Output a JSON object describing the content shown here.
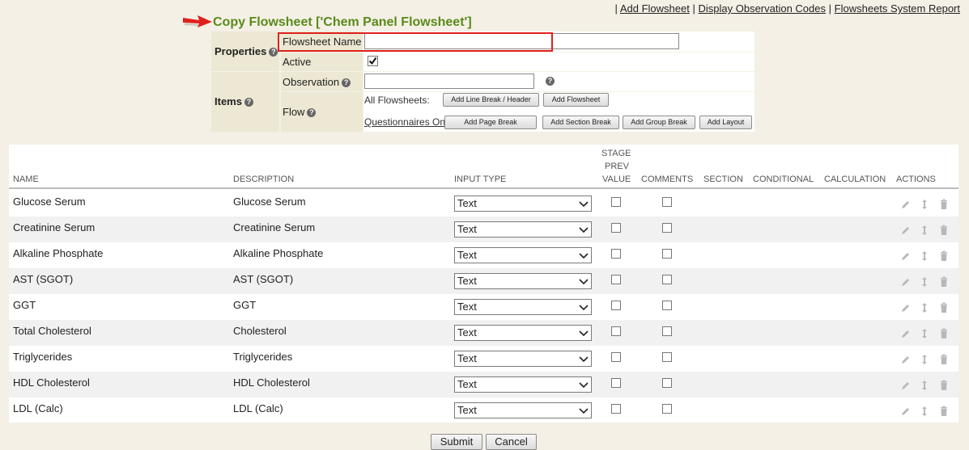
{
  "header": {
    "links": [
      "Add Flowsheet",
      "Display Observation Codes",
      "Flowsheets System Report"
    ],
    "separator": "|",
    "title": "Copy Flowsheet ['Chem Panel Flowsheet']"
  },
  "properties": {
    "section_label": "Properties",
    "flowsheet_name_label": "Flowsheet Name",
    "flowsheet_name_value": "",
    "active_label": "Active",
    "active_checked": true
  },
  "items": {
    "section_label": "Items",
    "observation_label": "Observation",
    "observation_value": "",
    "flow_label": "Flow",
    "all_flowsheets_label": "All Flowsheets:",
    "add_line_break_label": "Add Line Break / Header",
    "add_flowsheet_label": "Add Flowsheet",
    "questionnaires_only_label": "Questionnaires Only",
    "colon": ":",
    "add_page_break_label": "Add Page Break",
    "add_section_break_label": "Add Section Break",
    "add_group_break_label": "Add Group Break",
    "add_layout_label": "Add Layout"
  },
  "table": {
    "columns": {
      "name": "NAME",
      "description": "DESCRIPTION",
      "input_type": "INPUT TYPE",
      "stage_prev_value": [
        "STAGE",
        "PREV",
        "VALUE"
      ],
      "comments": "COMMENTS",
      "section": "SECTION",
      "conditional": "CONDITIONAL",
      "calculation": "CALCULATION",
      "actions": "ACTIONS"
    },
    "rows": [
      {
        "name": "Glucose Serum",
        "description": "Glucose Serum",
        "input_type": "Text"
      },
      {
        "name": "Creatinine Serum",
        "description": "Creatinine Serum",
        "input_type": "Text"
      },
      {
        "name": "Alkaline Phosphate",
        "description": "Alkaline Phosphate",
        "input_type": "Text"
      },
      {
        "name": "AST (SGOT)",
        "description": "AST (SGOT)",
        "input_type": "Text"
      },
      {
        "name": "GGT",
        "description": "GGT",
        "input_type": "Text"
      },
      {
        "name": "Total Cholesterol",
        "description": "Cholesterol",
        "input_type": "Text"
      },
      {
        "name": "Triglycerides",
        "description": "Triglycerides",
        "input_type": "Text"
      },
      {
        "name": "HDL Cholesterol",
        "description": "HDL Cholesterol",
        "input_type": "Text"
      },
      {
        "name": "LDL (Calc)",
        "description": "LDL (Calc)",
        "input_type": "Text"
      }
    ]
  },
  "footer": {
    "submit_label": "Submit",
    "cancel_label": "Cancel"
  },
  "colors": {
    "title_green": "#5a8a1a",
    "highlight_red": "#e0201c",
    "label_bg": "#ece8d3"
  },
  "icons": [
    "arrow-pointer-icon",
    "help-icon",
    "checkbox-icon",
    "chevron-down-icon",
    "edit-pencil-icon",
    "reorder-icon",
    "trash-icon"
  ]
}
